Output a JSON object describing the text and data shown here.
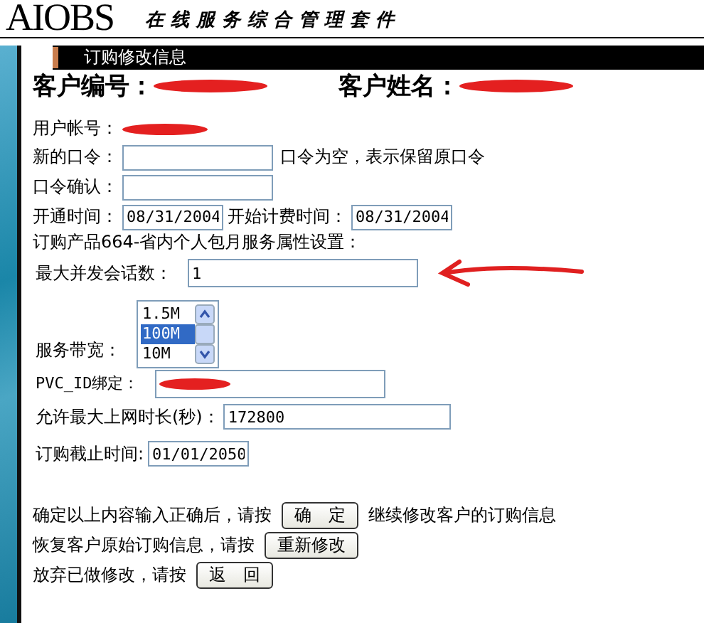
{
  "header": {
    "logo": "AIOBS",
    "subtitle": "在线服务综合管理套件"
  },
  "panel_title": "订购修改信息",
  "customer": [
    {
      "label": "客户编号："
    },
    {
      "label": "客户姓名："
    }
  ],
  "account": {
    "label": "用户帐号："
  },
  "fields": [
    {
      "label": "新的口令：",
      "note": "口令为空，表示保留原口令"
    },
    {
      "label": "口令确认："
    }
  ],
  "dates": [
    {
      "label": "开通时间：",
      "value": "08/31/2004"
    },
    {
      "label": "开始计费时间：",
      "value": "08/31/2004"
    }
  ],
  "product_heading": "订购产品664-省内个人包月服务属性设置：",
  "sessions": {
    "label": "最大并发会话数：",
    "value": "1"
  },
  "bandwidth": {
    "label": "服务带宽：",
    "options": [
      {
        "label": "1.5M",
        "selected": false
      },
      {
        "label": "100M",
        "selected": true
      },
      {
        "label": "10M",
        "selected": false
      }
    ]
  },
  "pvc": {
    "label": "PVC_ID绑定："
  },
  "max_time": {
    "label": "允许最大上网时长(秒)：",
    "value": "172800"
  },
  "expiry": {
    "label": "订购截止时间:",
    "value": "01/01/2050"
  },
  "actions": [
    {
      "before": "确定以上内容输入正确后，请按",
      "button": "确　定",
      "after": "继续修改客户的订购信息"
    },
    {
      "before": "恢复客户原始订购信息，请按",
      "button": "重新修改"
    },
    {
      "before": "放弃已做修改，请按",
      "button": "返　回"
    }
  ]
}
